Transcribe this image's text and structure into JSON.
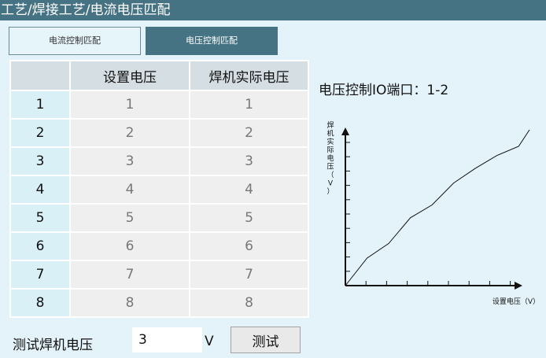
{
  "title": "工艺/焊接工艺/电流电压匹配",
  "tabs": [
    {
      "label": "电流控制匹配",
      "active": false
    },
    {
      "label": "电压控制匹配",
      "active": true
    }
  ],
  "table": {
    "headers": [
      "",
      "设置电压",
      "焊机实际电压"
    ],
    "rows": [
      {
        "index": "1",
        "set": "1",
        "actual": "1"
      },
      {
        "index": "2",
        "set": "2",
        "actual": "2"
      },
      {
        "index": "3",
        "set": "3",
        "actual": "3"
      },
      {
        "index": "4",
        "set": "4",
        "actual": "4"
      },
      {
        "index": "5",
        "set": "5",
        "actual": "5"
      },
      {
        "index": "6",
        "set": "6",
        "actual": "6"
      },
      {
        "index": "7",
        "set": "7",
        "actual": "7"
      },
      {
        "index": "8",
        "set": "8",
        "actual": "8"
      }
    ]
  },
  "io_port": {
    "label": "电压控制IO端口：",
    "value": "1-2"
  },
  "chart_data": {
    "type": "line",
    "xlabel": "设置电压（V）",
    "ylabel": "焊机实际电压（V）",
    "ylabel_chars": [
      "焊",
      "机",
      "实",
      "际",
      "电",
      "压",
      "（",
      "V",
      "）"
    ],
    "x_ticks": 8,
    "y_ticks": 10,
    "series": [
      {
        "x": [
          0,
          1,
          2,
          3,
          4,
          5,
          6,
          7,
          8,
          8.5
        ],
        "y": [
          0,
          1.5,
          2.3,
          3.7,
          4.4,
          5.6,
          6.4,
          7.1,
          7.6,
          8.5
        ]
      }
    ],
    "xlim": [
      0,
      8.5
    ],
    "ylim": [
      0,
      8.5
    ],
    "grid": false
  },
  "test": {
    "label": "测试焊机电压",
    "value": "3",
    "unit": "V",
    "button_label": "测试"
  },
  "colors": {
    "titlebar": "#467383",
    "tab_active": "#467383",
    "background": "#e3f3f9",
    "header_cell": "#d5dee3",
    "row_head": "#d9f0f7",
    "data_cell": "#efefef"
  }
}
